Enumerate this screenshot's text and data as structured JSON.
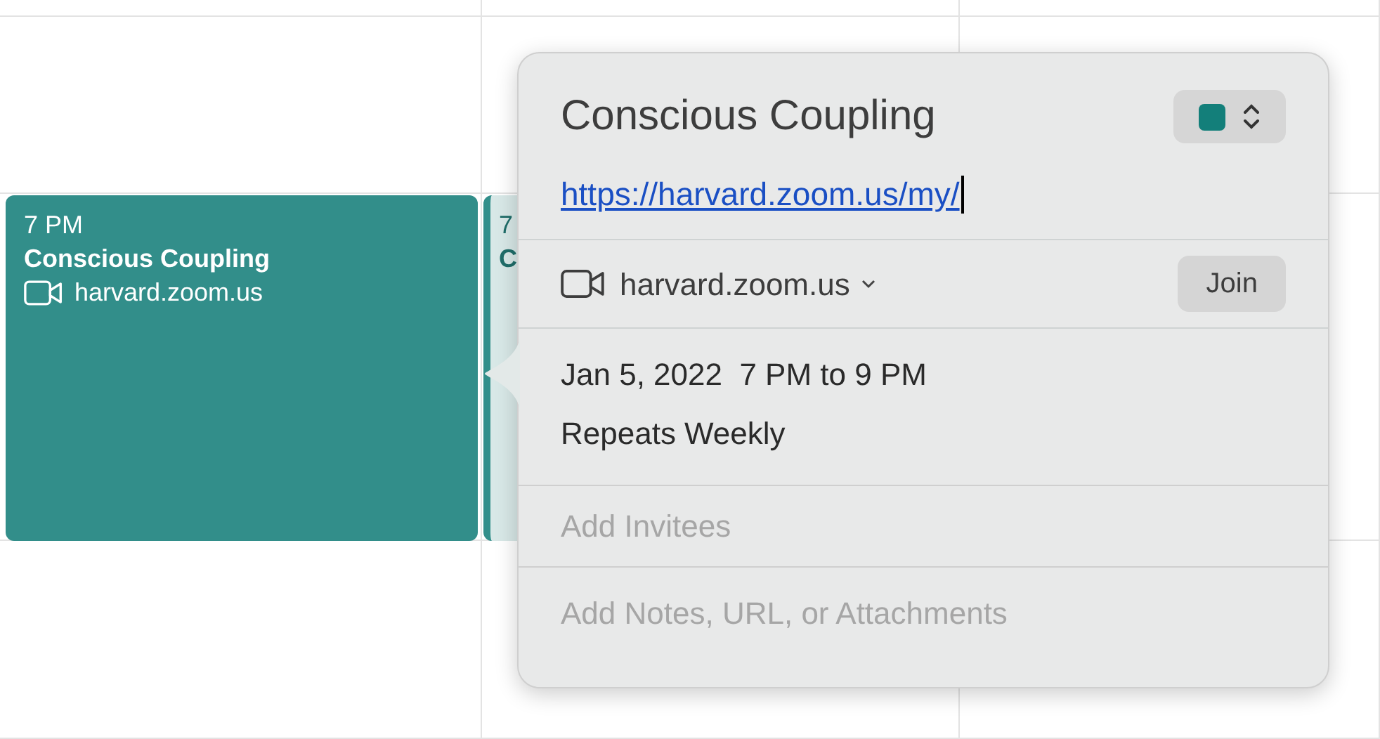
{
  "events": [
    {
      "time": "7 PM",
      "title": "Conscious Coupling",
      "location": "harvard.zoom.us",
      "color": "#328e8a"
    },
    {
      "time": "7",
      "title": "C",
      "color": "#328e8a"
    }
  ],
  "popover": {
    "title": "Conscious Coupling",
    "calendar": {
      "color": "#137f7a"
    },
    "url": "https://harvard.zoom.us/my/",
    "video": {
      "label": "harvard.zoom.us",
      "button": "Join"
    },
    "date": "Jan 5, 2022  7 PM to 9 PM",
    "repeat": "Repeats Weekly",
    "invitees_placeholder": "Add Invitees",
    "notes_placeholder": "Add Notes, URL, or Attachments"
  }
}
